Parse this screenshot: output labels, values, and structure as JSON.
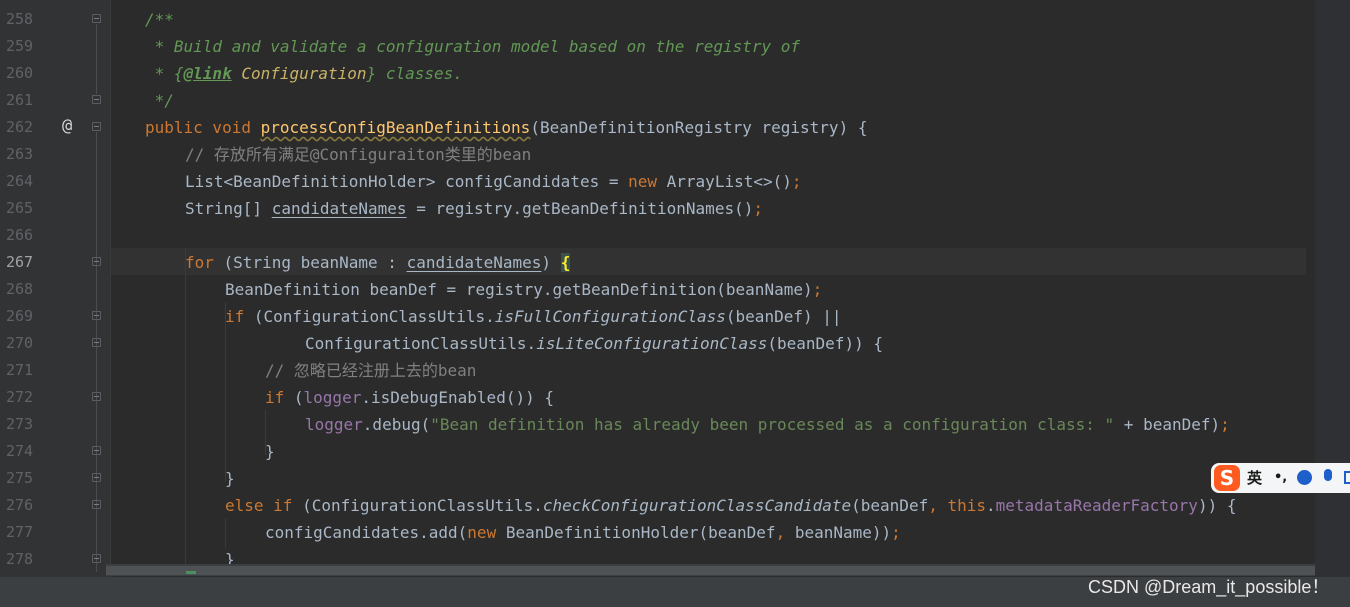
{
  "editor": {
    "line_numbers": [
      "258",
      "259",
      "260",
      "261",
      "262",
      "263",
      "264",
      "265",
      "266",
      "267",
      "268",
      "269",
      "270",
      "271",
      "272",
      "273",
      "274",
      "275",
      "276",
      "277",
      "278"
    ],
    "current_line": "267",
    "override_marker": "@",
    "code": {
      "l258": "/**",
      "l259": " * Build and validate a configuration model based on the registry of",
      "l260_a": " * {",
      "l260_tag": "@link",
      "l260_ref": " Configuration",
      "l260_b": "} classes.",
      "l261": " */",
      "l262_kw": "public void ",
      "l262_method": "processConfigBeanDefinitions",
      "l262_rest": "(BeanDefinitionRegistry registry) {",
      "l263": "// 存放所有满足@Configuraiton类里的bean",
      "l264_a": "List<BeanDefinitionHolder> configCandidates = ",
      "l264_kw": "new",
      "l264_b": " ArrayList<>()",
      "l264_semi": ";",
      "l265_a": "String[] ",
      "l265_var": "candidateNames",
      "l265_b": " = registry.getBeanDefinitionNames()",
      "l265_semi": ";",
      "l267_kw": "for",
      "l267_a": " (String beanName : ",
      "l267_var": "candidateNames",
      "l267_b": ") ",
      "l267_brace": "{",
      "l268_a": "BeanDefinition beanDef = registry.getBeanDefinition(beanName)",
      "l268_semi": ";",
      "l269_kw": "if",
      "l269_a": " (ConfigurationClassUtils.",
      "l269_m": "isFullConfigurationClass",
      "l269_b": "(beanDef) ||",
      "l270_a": "ConfigurationClassUtils.",
      "l270_m": "isLiteConfigurationClass",
      "l270_b": "(beanDef)) {",
      "l271": "// 忽略已经注册上去的bean",
      "l272_kw": "if",
      "l272_a": " (",
      "l272_fld": "logger",
      "l272_b": ".isDebugEnabled()) {",
      "l273_fld": "logger",
      "l273_a": ".debug(",
      "l273_str": "\"Bean definition has already been processed as a configuration class: \"",
      "l273_b": " + beanDef)",
      "l273_semi": ";",
      "l274": "}",
      "l275": "}",
      "l276_kw1": "else if",
      "l276_a": " (ConfigurationClassUtils.",
      "l276_m": "checkConfigurationClassCandidate",
      "l276_b": "(beanDef",
      "l276_comma": ", ",
      "l276_kw2": "this",
      "l276_dot": ".",
      "l276_fld": "metadataReaderFactory",
      "l276_c": ")) {",
      "l277_a": "configCandidates.add(",
      "l277_kw": "new",
      "l277_b": " BeanDefinitionHolder(beanDef",
      "l277_comma": ", ",
      "l277_c": "beanName))",
      "l277_semi": ";",
      "l278": "}"
    }
  },
  "ime_toolbar": {
    "logo": "S",
    "mode": "英",
    "punct": "•,"
  },
  "watermark": "CSDN @Dream_it_possible！",
  "colors": {
    "background": "#2b2b2b",
    "keyword": "#cc7832",
    "doc_comment": "#629755",
    "line_comment": "#808080",
    "string": "#6a8759",
    "field": "#9876aa",
    "method_decl": "#ffc66d",
    "default_text": "#a9b7c6"
  }
}
